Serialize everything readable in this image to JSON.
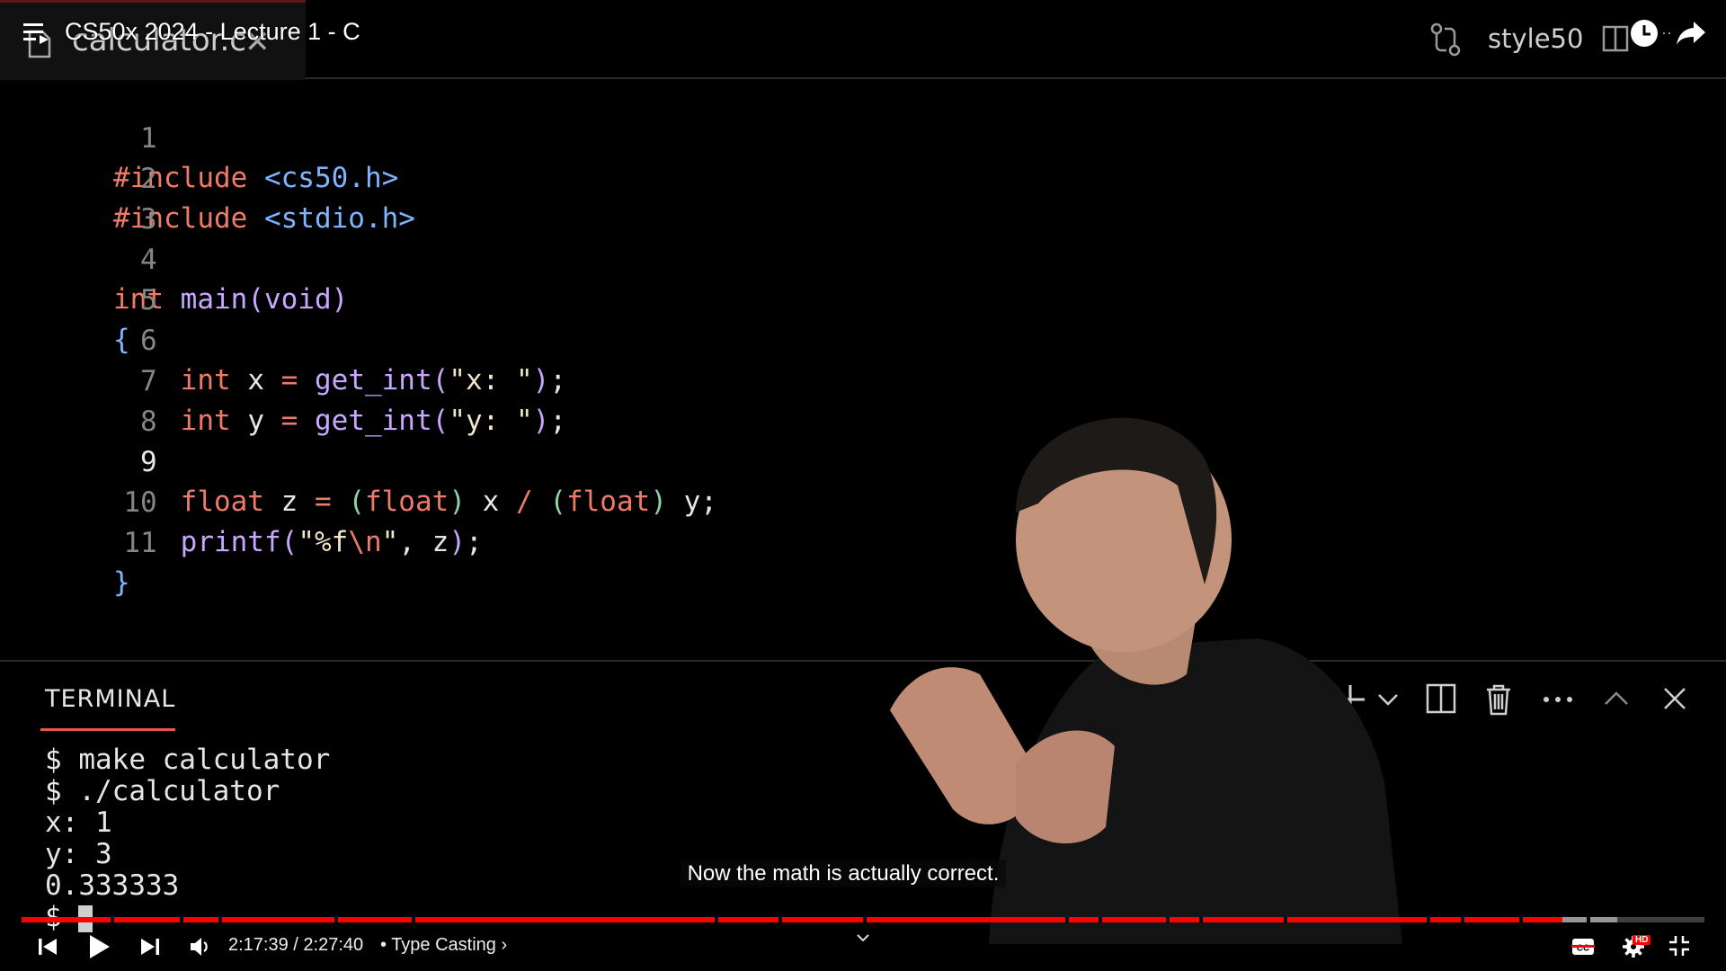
{
  "editor": {
    "file_tab": "calculator.c",
    "style_button": "style50",
    "active_line": 9,
    "lines": [
      {
        "n": "1"
      },
      {
        "n": "2"
      },
      {
        "n": "3"
      },
      {
        "n": "4"
      },
      {
        "n": "5"
      },
      {
        "n": "6"
      },
      {
        "n": "7"
      },
      {
        "n": "8"
      },
      {
        "n": "9"
      },
      {
        "n": "10"
      },
      {
        "n": "11"
      }
    ],
    "code": {
      "l1a": "#include",
      "l1b": " <cs50.h>",
      "l2a": "#include",
      "l2b": " <stdio.h>",
      "l4a": "int",
      "l4b": " main",
      "l4c": "(",
      "l4d": "void",
      "l4e": ")",
      "l5": "{",
      "l6a": "    int",
      "l6b": " x ",
      "l6c": "=",
      "l6d": " get_int",
      "l6e": "(",
      "l6f": "\"x: \"",
      "l6g": ")",
      "l6h": ";",
      "l7a": "    int",
      "l7b": " y ",
      "l7c": "=",
      "l7d": " get_int",
      "l7e": "(",
      "l7f": "\"y: \"",
      "l7g": ")",
      "l7h": ";",
      "l9a": "    float",
      "l9b": " z ",
      "l9c": "=",
      "l9d": " (",
      "l9e": "float",
      "l9f": ")",
      "l9g": " x ",
      "l9h": "/",
      "l9i": " (",
      "l9j": "float",
      "l9k": ")",
      "l9l": " y;",
      "l10a": "    printf",
      "l10b": "(",
      "l10c": "\"%f",
      "l10d": "\\n",
      "l10e": "\"",
      "l10f": ", z",
      "l10g": ")",
      "l10h": ";",
      "l11": "}"
    }
  },
  "terminal": {
    "tab_label": "TERMINAL",
    "lines": [
      "$ make calculator",
      "$ ./calculator",
      "x: 1",
      "y: 3",
      "0.333333"
    ],
    "prompt": "$ "
  },
  "player": {
    "video_title": "CS50x 2024 - Lecture 1 - C",
    "caption": "Now the math is actually correct.",
    "time": "2:17:39 / 2:27:40",
    "chapter": "• Type Casting",
    "chapter_chevron": "›",
    "progress": 0.9157,
    "loaded": 0.948,
    "hd_badge": "HD",
    "cc_label": "CC"
  },
  "colors": {
    "progress": "#ff0000",
    "keyword": "#f07a6a",
    "header": "#7fb4ff",
    "function": "#c8a8ff",
    "paren": "#8fd3a8"
  },
  "icons": [
    "playlist-icon",
    "file-icon",
    "close-icon",
    "compare-icon",
    "split-editor-icon",
    "watch-later-icon",
    "share-icon",
    "new-terminal-icon",
    "chevron-down-icon",
    "split-terminal-icon",
    "trash-icon",
    "more-icon",
    "maximize-panel-icon",
    "close-panel-icon",
    "skip-previous-icon",
    "play-icon",
    "skip-next-icon",
    "volume-icon",
    "cc-icon",
    "settings-icon",
    "exit-fullscreen-icon"
  ]
}
